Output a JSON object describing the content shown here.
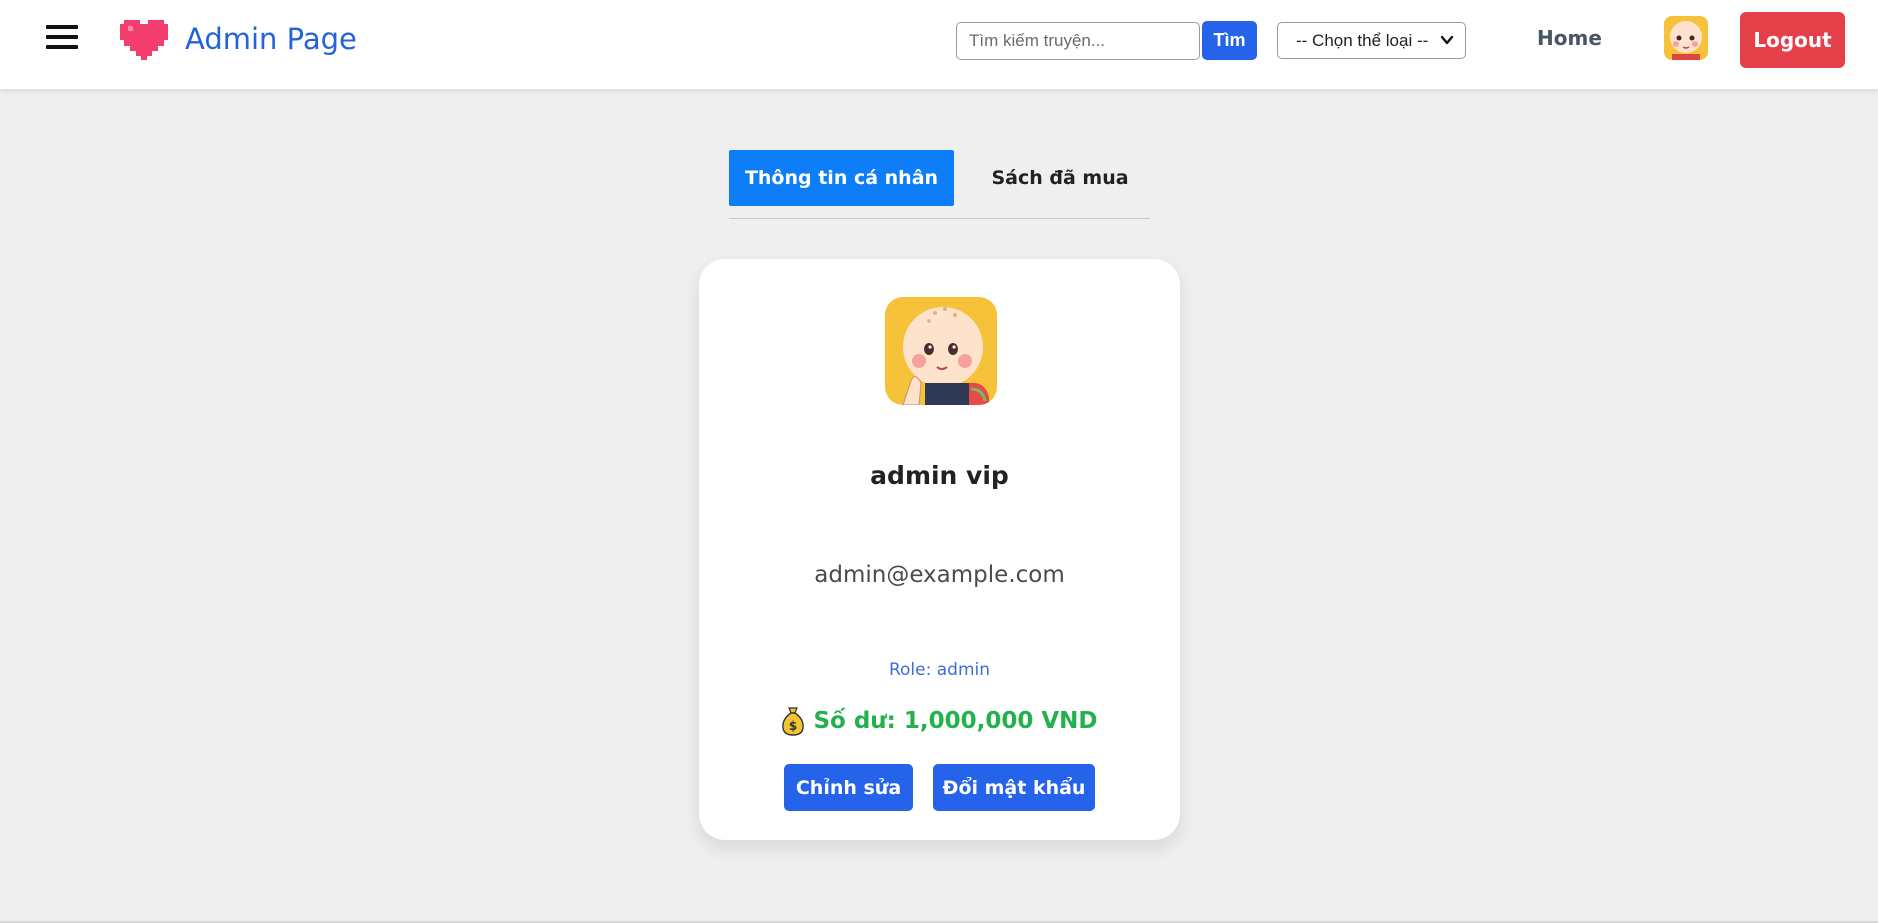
{
  "navbar": {
    "brand": "Admin Page",
    "search_placeholder": "Tìm kiếm truyện...",
    "search_button": "Tìm",
    "genre_select": "-- Chọn thể loại --",
    "home_link": "Home",
    "logout_button": "Logout"
  },
  "tabs": [
    {
      "label": "Thông tin cá nhân",
      "active": true
    },
    {
      "label": "Sách đã mua",
      "active": false
    }
  ],
  "profile": {
    "username": "admin vip",
    "email": "admin@example.com",
    "role": "Role: admin",
    "balance": "Số dư: 1,000,000 VND",
    "edit_button": "Chỉnh sửa",
    "change_password_button": "Đổi mật khẩu"
  },
  "colors": {
    "brand": "#2563d9",
    "primary_button": "#2563eb",
    "tab_active": "#0d7df8",
    "logout": "#e5404a",
    "balance": "#22b14c",
    "heart": "#f23d6d"
  },
  "icons": [
    "menu-icon",
    "heart-logo-icon",
    "chevron-down-icon",
    "money-bag-icon"
  ]
}
